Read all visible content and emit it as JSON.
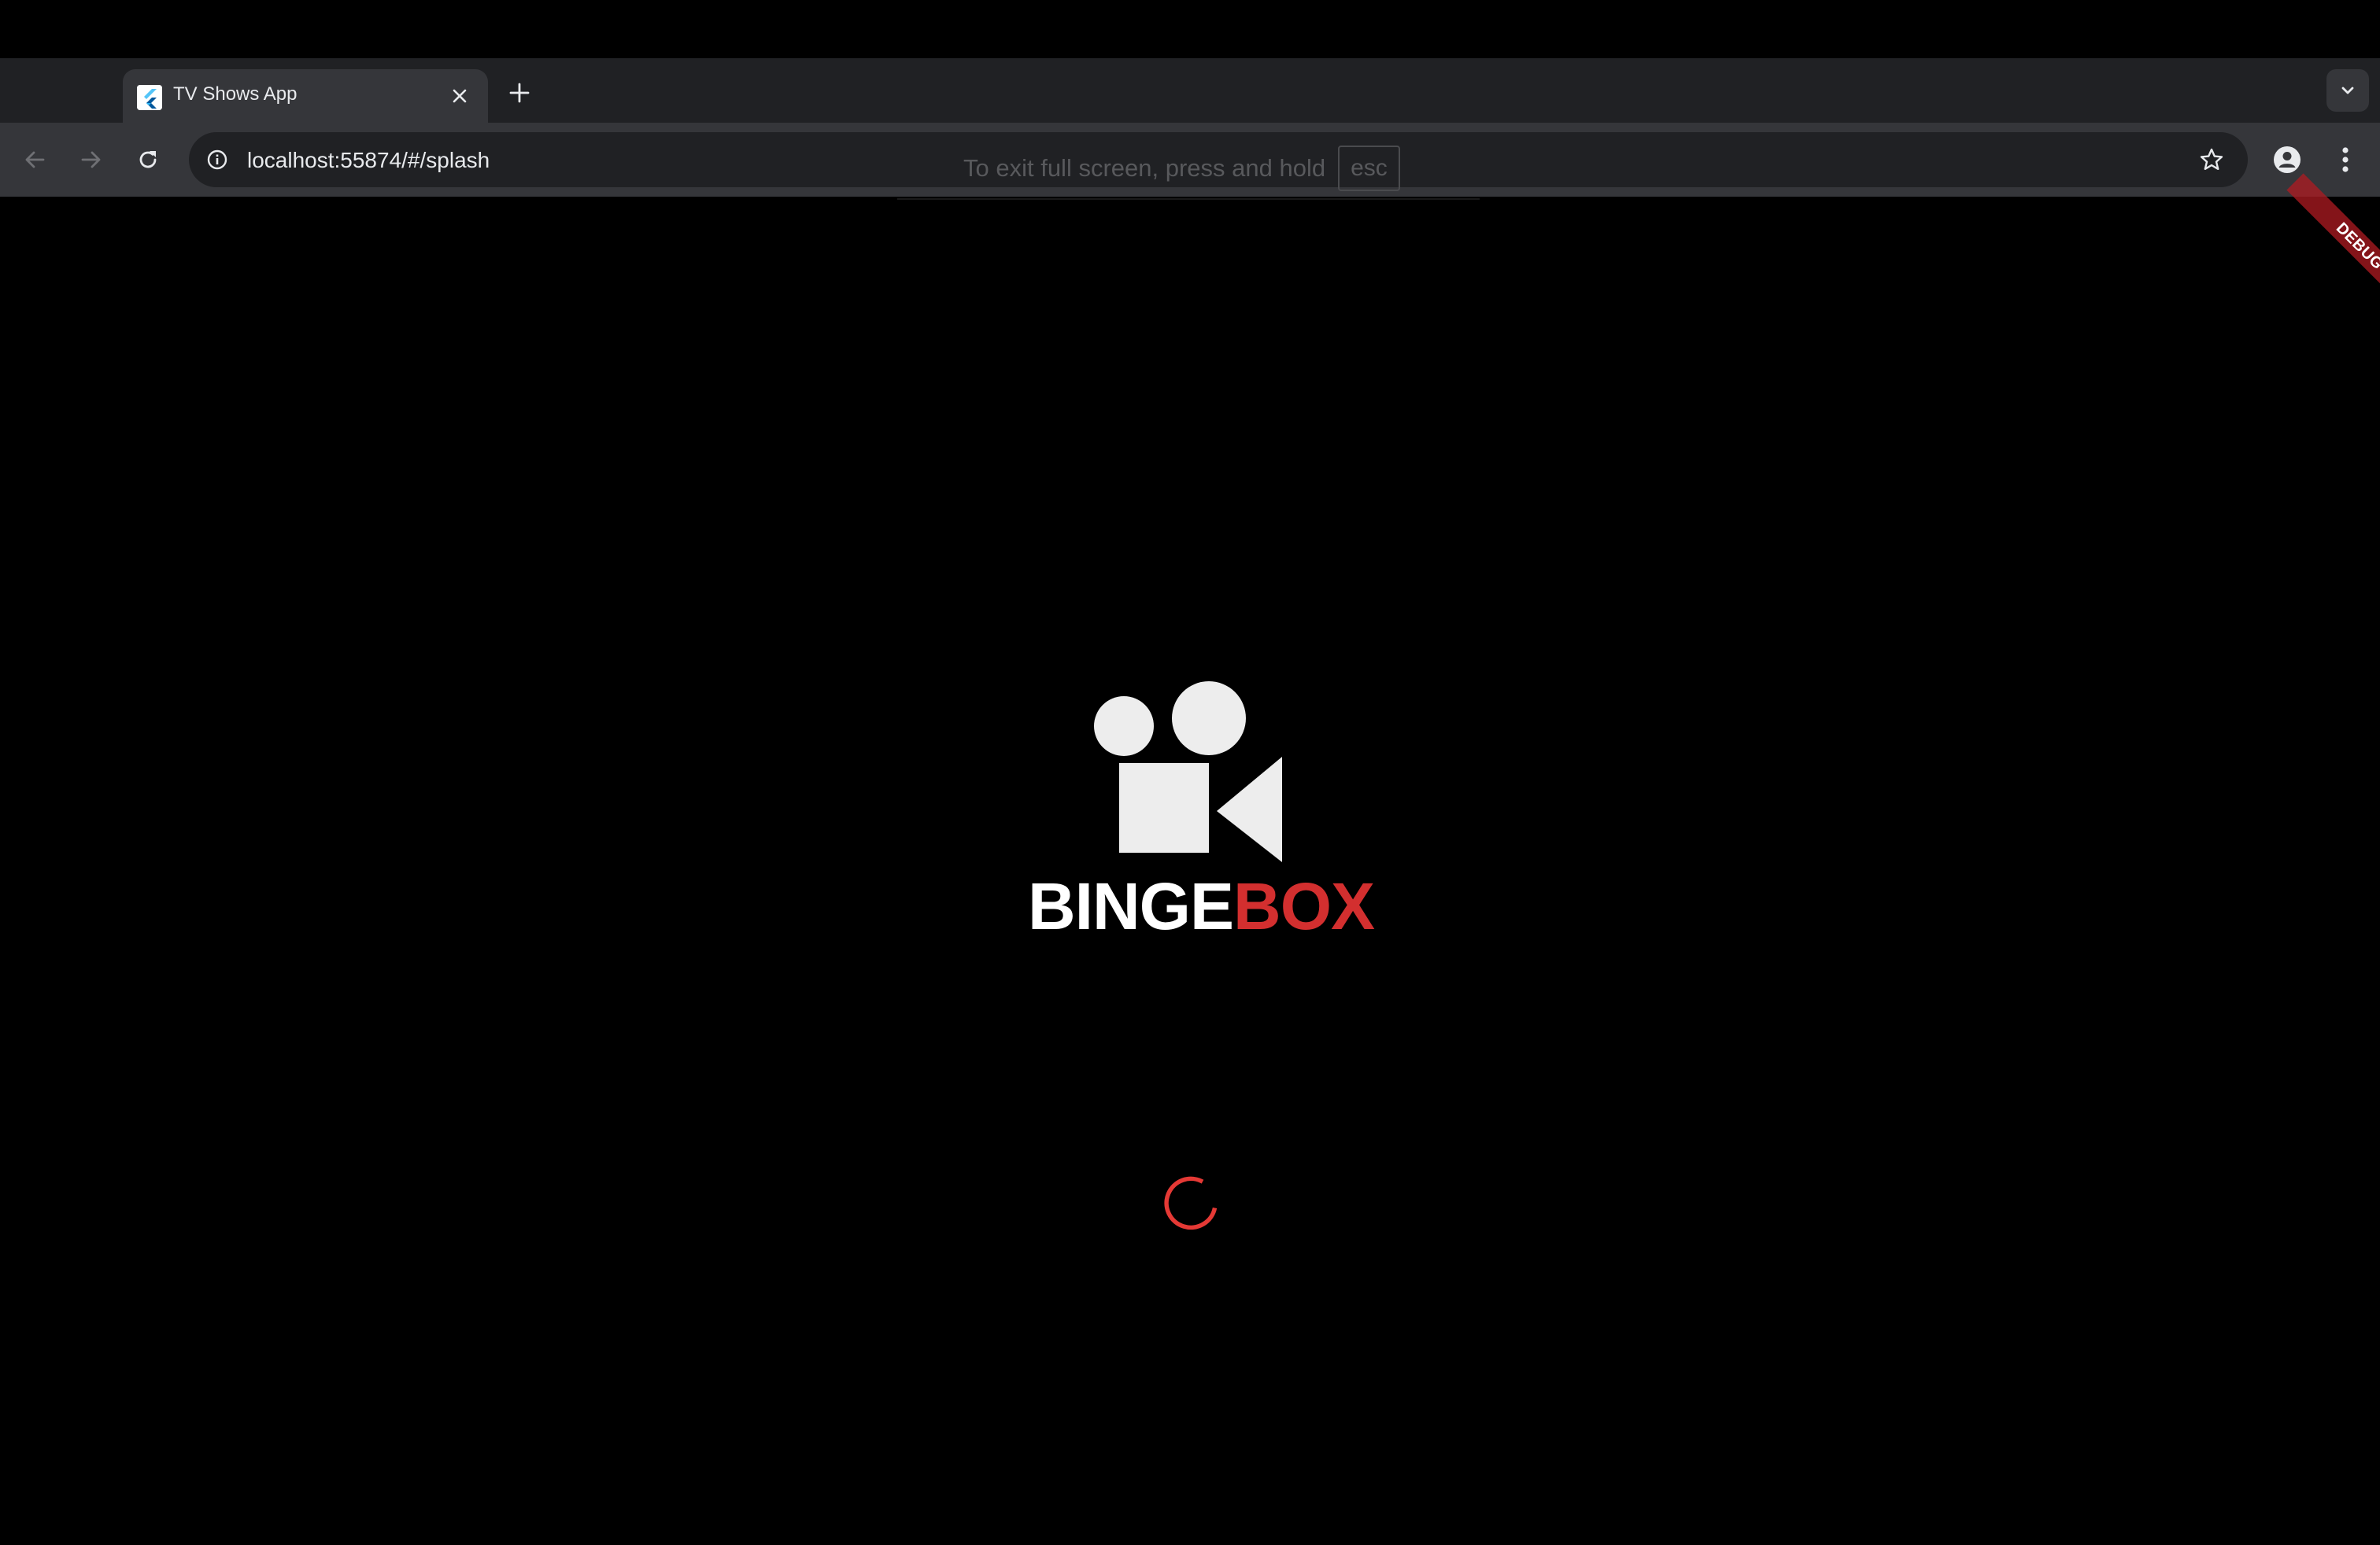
{
  "browser": {
    "tab": {
      "title": "TV Shows App",
      "favicon": "flutter-icon"
    },
    "new_tab_icon": "plus-icon",
    "tab_search_icon": "chevron-down-icon",
    "nav": {
      "back_icon": "arrow-left-icon",
      "forward_icon": "arrow-right-icon",
      "reload_icon": "reload-icon"
    },
    "omnibox": {
      "url": "localhost:55874/#/splash",
      "info_icon": "info-icon",
      "bookmark_icon": "star-icon"
    },
    "profile_icon": "person-icon",
    "menu_icon": "kebab-menu-icon"
  },
  "fullscreen_hint": {
    "text": "To exit full screen, press and hold",
    "key": "esc"
  },
  "debug_banner": {
    "label": "DEBUG",
    "color": "#b01b21"
  },
  "splash": {
    "logo_icon": "video-camera-icon",
    "brand_part1": "BINGE",
    "brand_part2": "BOX",
    "brand_accent_color": "#d32f2f",
    "loading_indicator": "circular-progress"
  }
}
